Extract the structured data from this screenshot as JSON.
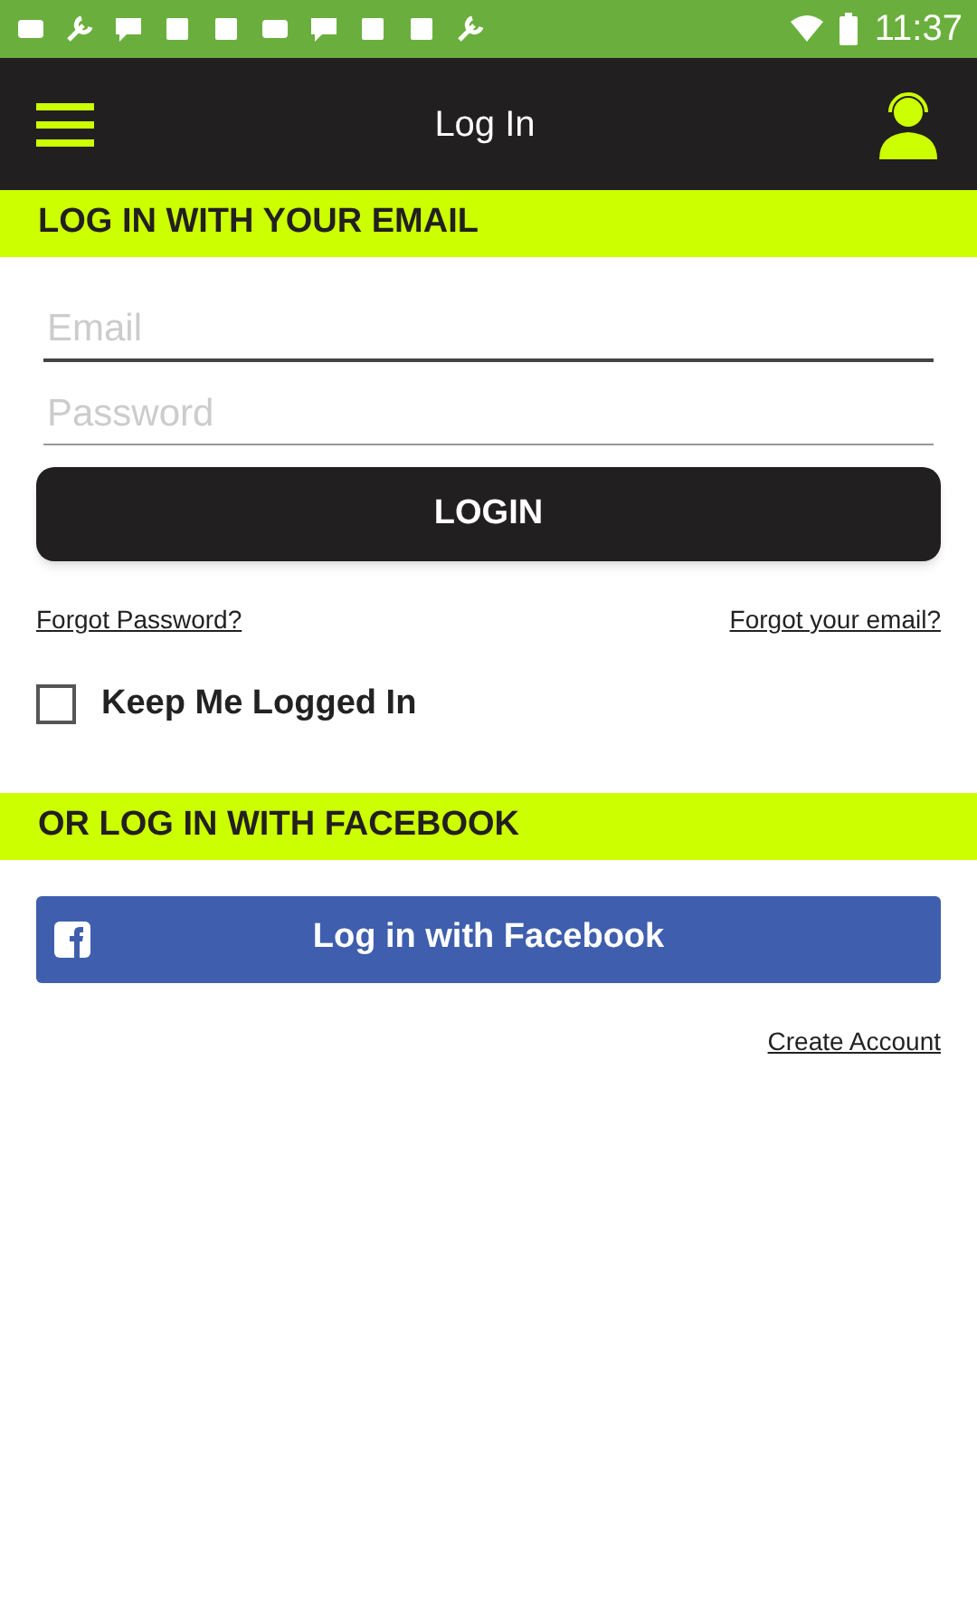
{
  "status_bar": {
    "time": "11:37"
  },
  "header": {
    "title": "Log In"
  },
  "email_section": {
    "heading": "LOG IN WITH YOUR EMAIL"
  },
  "email_field": {
    "placeholder": "Email"
  },
  "password_field": {
    "placeholder": "Password"
  },
  "login_button": "LOGIN",
  "forgot_password": "Forgot Password?",
  "forgot_email": "Forgot your email?",
  "keep_logged_in": {
    "label": "Keep Me Logged In",
    "checked": false
  },
  "facebook_section": {
    "heading": "OR LOG IN WITH FACEBOOK"
  },
  "facebook_button": "Log in with Facebook",
  "create_account": "Create Account"
}
